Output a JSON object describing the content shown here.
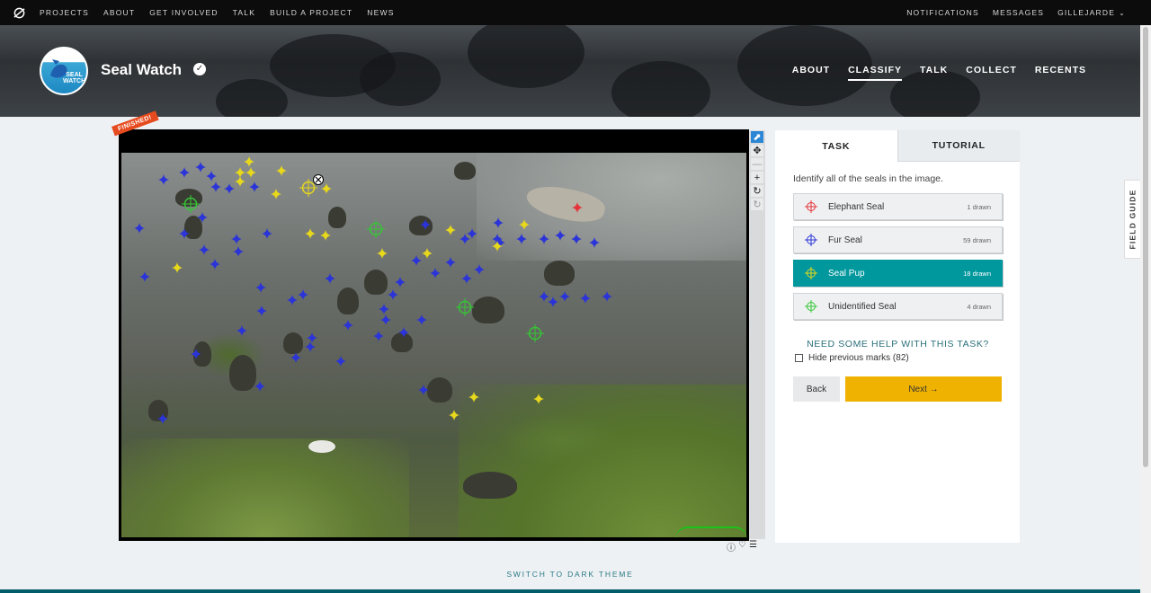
{
  "topnav": {
    "links": [
      "PROJECTS",
      "ABOUT",
      "GET INVOLVED",
      "TALK",
      "BUILD A PROJECT",
      "NEWS"
    ],
    "notifications": "NOTIFICATIONS",
    "messages": "MESSAGES",
    "user": "GILLEJARDE"
  },
  "project": {
    "avatar_text_1": "SEAL",
    "avatar_text_2": "WATCH",
    "title": "Seal Watch",
    "nav": [
      "ABOUT",
      "CLASSIFY",
      "TALK",
      "COLLECT",
      "RECENTS"
    ],
    "active_nav": "CLASSIFY"
  },
  "viewer": {
    "badge": "FINISHED!"
  },
  "task": {
    "tab_task": "TASK",
    "tab_tutorial": "TUTORIAL",
    "question": "Identify all of the seals in the image.",
    "tools": [
      {
        "label": "Elephant Seal",
        "count": "1 drawn",
        "color": "#e5333a"
      },
      {
        "label": "Fur Seal",
        "count": "59 drawn",
        "color": "#2a34d8"
      },
      {
        "label": "Seal Pup",
        "count": "18 drawn",
        "color": "#e7d81c"
      },
      {
        "label": "Unidentified Seal",
        "count": "4 drawn",
        "color": "#34c734"
      }
    ],
    "help": "NEED SOME HELP WITH THIS TASK?",
    "hide_marks": "Hide previous marks (82)",
    "back": "Back",
    "next": "Next →"
  },
  "field_guide": "FIELD GUIDE",
  "switch_theme": "SWITCH TO DARK THEME"
}
